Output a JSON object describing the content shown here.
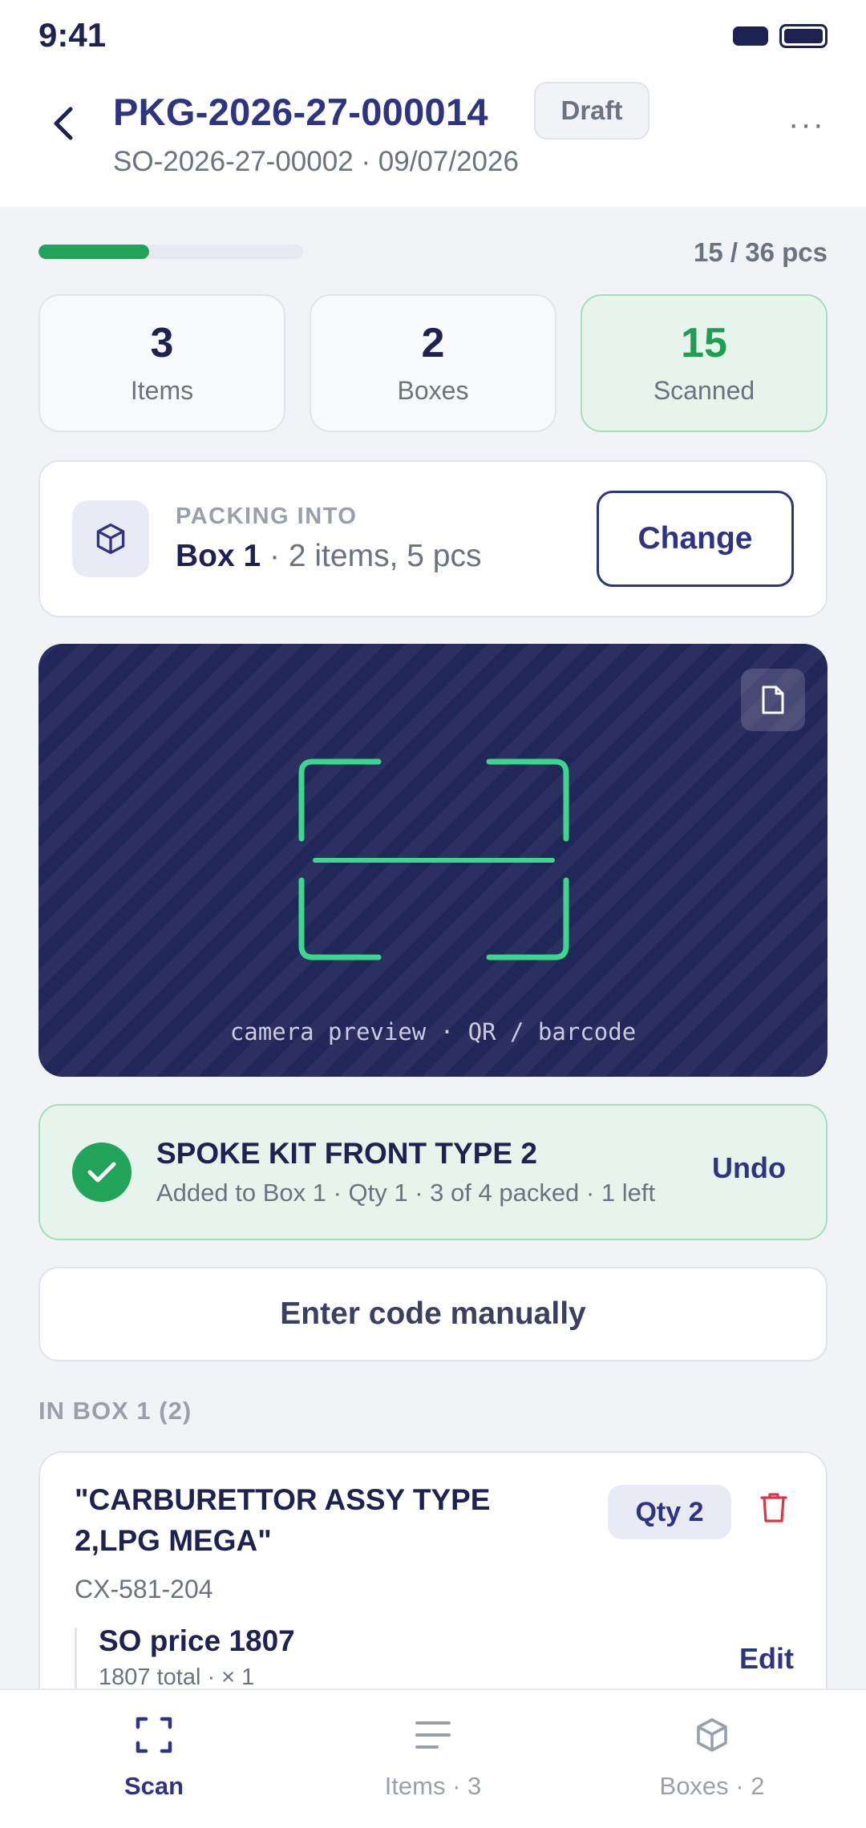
{
  "status_bar": {
    "time": "9:41"
  },
  "header": {
    "title": "PKG-2026-27-000014",
    "badge": "Draft",
    "subtitle": "SO-2026-27-00002 · 09/07/2026",
    "more_label": "···"
  },
  "progress": {
    "packed": 15,
    "total": 36,
    "fraction": 0.4167,
    "text": "15 / 36 pcs"
  },
  "stats": [
    {
      "value": "3",
      "label": "Items"
    },
    {
      "value": "2",
      "label": "Boxes"
    },
    {
      "value": "15",
      "label": "Scanned"
    }
  ],
  "packing": {
    "label": "PACKING INTO",
    "box": "Box 1",
    "detail": " · 2 items, 5 pcs",
    "change_label": "Change",
    "icon": "cube-icon"
  },
  "camera": {
    "caption": "camera preview · QR / barcode",
    "icon": "document-icon"
  },
  "scan_result": {
    "title": "SPOKE KIT FRONT TYPE 2",
    "subtitle": "Added to Box 1 · Qty 1 · 3 of 4 packed · 1 left",
    "undo_label": "Undo",
    "icon": "check-icon"
  },
  "manual": {
    "label": "Enter code manually"
  },
  "box_section": {
    "label": "IN BOX 1 (2)"
  },
  "items": [
    {
      "name": "\"CARBURETTOR ASSY TYPE 2,LPG MEGA\"",
      "qty": "Qty 2",
      "sku": "CX-581-204",
      "price_title": "SO price 1807",
      "price_sub": "1807 total · × 1",
      "edit_label": "Edit"
    }
  ],
  "nav": [
    {
      "label": "Scan",
      "icon": "scan-icon",
      "active": true
    },
    {
      "label": "Items · 3",
      "icon": "list-icon",
      "active": false
    },
    {
      "label": "Boxes · 2",
      "icon": "cube-icon",
      "active": false
    }
  ],
  "colors": {
    "primary": "#2e3482",
    "success": "#22a35a",
    "danger": "#dc3545",
    "camera_bg": "#22275a",
    "scan_frame": "#3dd68c"
  }
}
